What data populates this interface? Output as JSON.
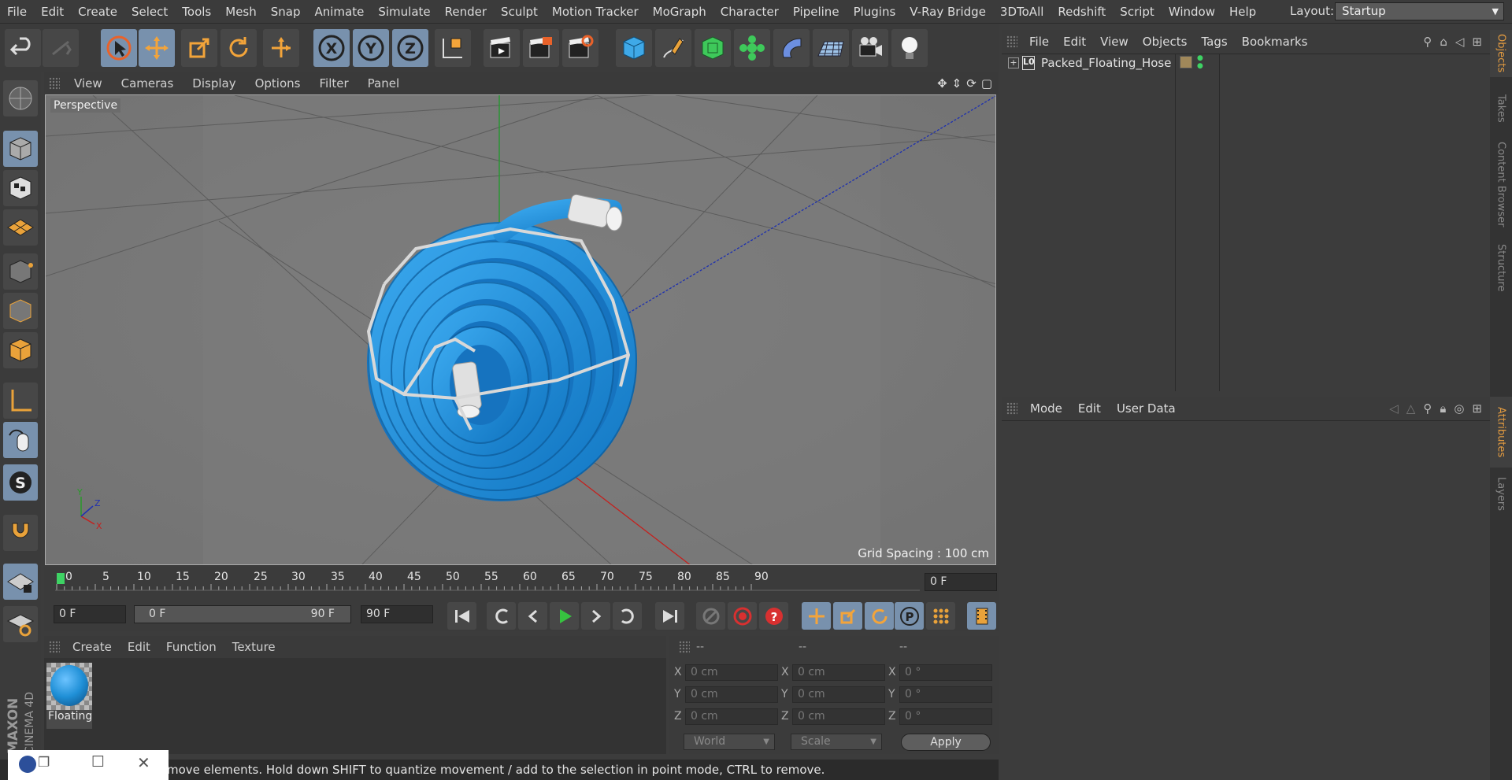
{
  "menubar": {
    "items": [
      "File",
      "Edit",
      "Create",
      "Select",
      "Tools",
      "Mesh",
      "Snap",
      "Animate",
      "Simulate",
      "Render",
      "Sculpt",
      "Motion Tracker",
      "MoGraph",
      "Character",
      "Pipeline",
      "Plugins",
      "V-Ray Bridge",
      "3DToAll",
      "Redshift",
      "Script",
      "Window",
      "Help"
    ],
    "layout_label": "Layout:",
    "layout_value": "Startup"
  },
  "toolbar": {
    "axis_x": "X",
    "axis_y": "Y",
    "axis_z": "Z"
  },
  "viewport": {
    "menu": [
      "View",
      "Cameras",
      "Display",
      "Options",
      "Filter",
      "Panel"
    ],
    "camera_label": "Perspective",
    "grid_spacing": "Grid Spacing : 100 cm",
    "axis_x": "X",
    "axis_y": "Y",
    "axis_z": "Z"
  },
  "timeline": {
    "ticks": [
      "0",
      "5",
      "10",
      "15",
      "20",
      "25",
      "30",
      "35",
      "40",
      "45",
      "50",
      "55",
      "60",
      "65",
      "70",
      "75",
      "80",
      "85",
      "90"
    ],
    "current_frame": "0 F",
    "start_frame": "0 F",
    "range_start": "0 F",
    "range_end": "90 F",
    "end_frame": "90 F"
  },
  "material_manager": {
    "menu": [
      "Create",
      "Edit",
      "Function",
      "Texture"
    ],
    "material_name": "Floating",
    "material_color": "#1f8fd6"
  },
  "coordinates": {
    "headers": [
      "--",
      "--",
      "--"
    ],
    "rows": [
      {
        "axis": "X",
        "pos": "0 cm",
        "size": "0 cm",
        "rot": "0 °"
      },
      {
        "axis": "Y",
        "pos": "0 cm",
        "size": "0 cm",
        "rot": "0 °"
      },
      {
        "axis": "Z",
        "pos": "0 cm",
        "size": "0 cm",
        "rot": "0 °"
      }
    ],
    "space": "World",
    "mode": "Scale",
    "apply_label": "Apply"
  },
  "object_manager": {
    "menu": [
      "File",
      "Edit",
      "View",
      "Objects",
      "Tags",
      "Bookmarks"
    ],
    "objects": [
      {
        "name": "Packed_Floating_Hose"
      }
    ]
  },
  "attribute_manager": {
    "menu": [
      "Mode",
      "Edit",
      "User Data"
    ]
  },
  "right_tabs": [
    "Objects",
    "Takes",
    "Content Browser",
    "Structure",
    "Attributes",
    "Layers"
  ],
  "status_text": "move elements. Hold down SHIFT to quantize movement / add to the selection in point mode, CTRL to remove.",
  "brand": {
    "line1": "MAXON",
    "line2": "CINEMA 4D"
  },
  "colors": {
    "accent_blue": "#7891ad",
    "hose_blue": "#1f8fd6",
    "orange": "#e39b40"
  }
}
